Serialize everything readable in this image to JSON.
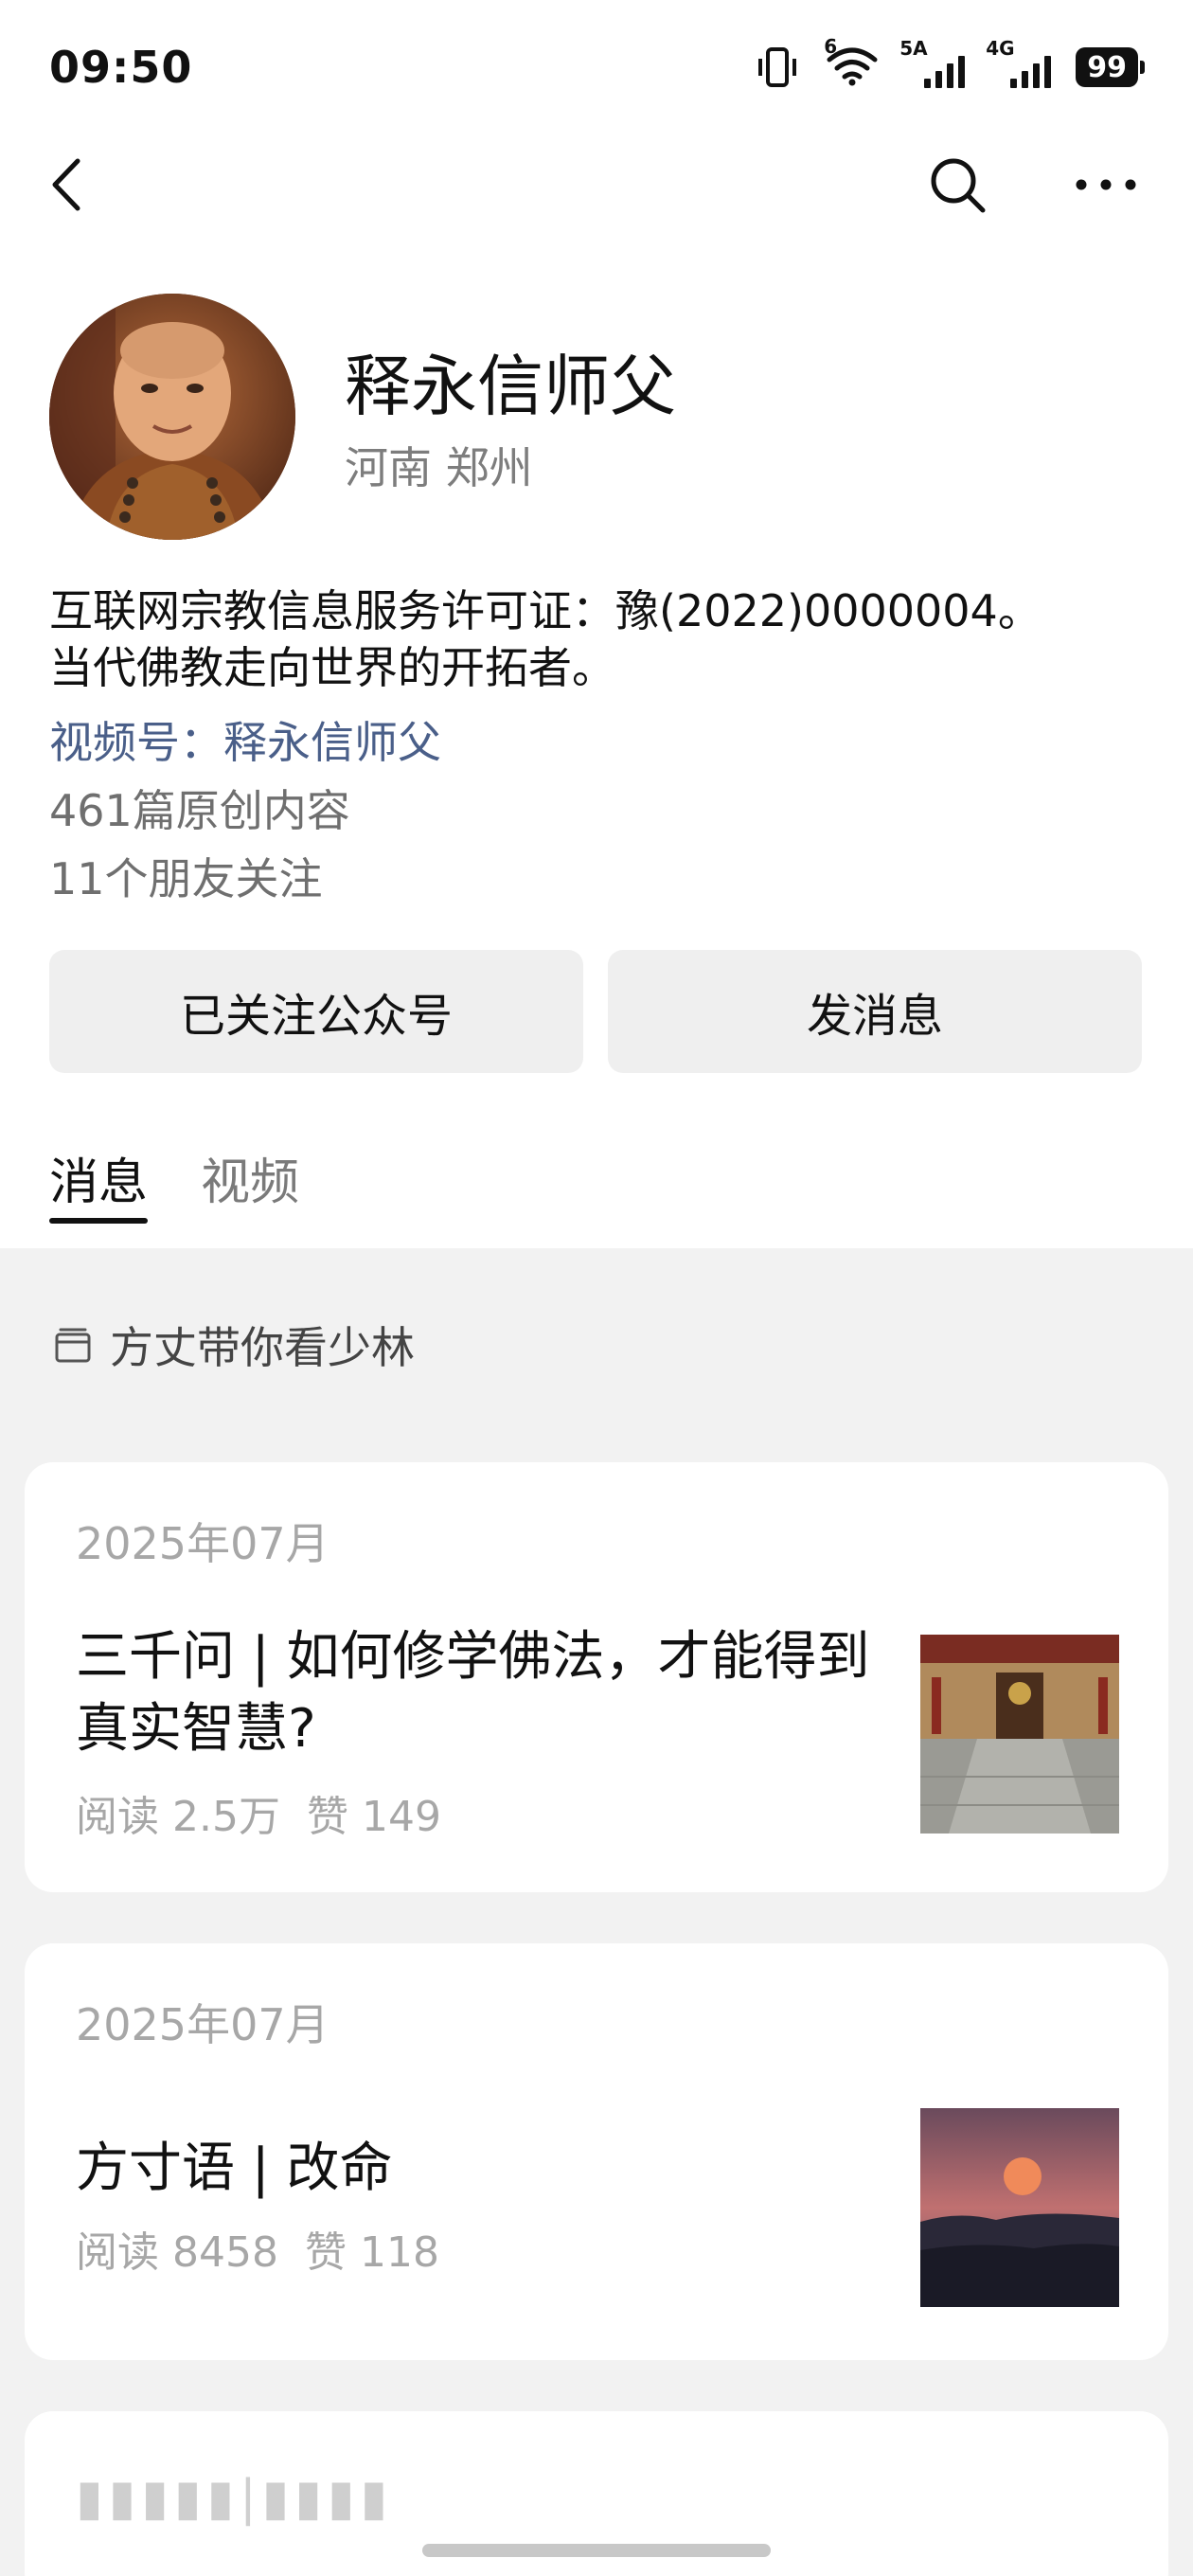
{
  "status_bar": {
    "time": "09:50",
    "wifi_label": "6",
    "signal_1_label": "5A",
    "signal_2_label": "4G",
    "battery": "99"
  },
  "nav": {
    "back_icon": "chevron-left-icon",
    "search_icon": "search-icon",
    "more_icon": "more-horizontal-icon"
  },
  "profile": {
    "name": "释永信师父",
    "location": "河南 郑州",
    "bio_line_1": "互联网宗教信息服务许可证：豫(2022)0000004。",
    "bio_line_2": "当代佛教走向世界的开拓者。",
    "channel": "视频号：释永信师父",
    "articles_count": "461篇原创内容",
    "friends_following": "11个朋友关注"
  },
  "actions": {
    "follow_label": "已关注公众号",
    "message_label": "发消息"
  },
  "tabs": [
    {
      "label": "消息",
      "active": true
    },
    {
      "label": "视频",
      "active": false
    }
  ],
  "collection": {
    "icon": "folder-icon",
    "label": "方丈带你看少林"
  },
  "posts": [
    {
      "date": "2025年07月",
      "title": "三千问 | 如何修学佛法，才能得到真实智慧?",
      "reads": "阅读 2.5万",
      "likes": "赞 149",
      "thumb": "temple-hall-thumbnail"
    },
    {
      "date": "2025年07月",
      "title": "方寸语 | 改命",
      "reads": "阅读 8458",
      "likes": "赞 118",
      "thumb": "sunset-thumbnail"
    }
  ],
  "colors": {
    "link": "#4a5f89",
    "muted": "#a7a7a7",
    "page_bg": "#f2f2f2",
    "button_bg": "#efefef"
  }
}
